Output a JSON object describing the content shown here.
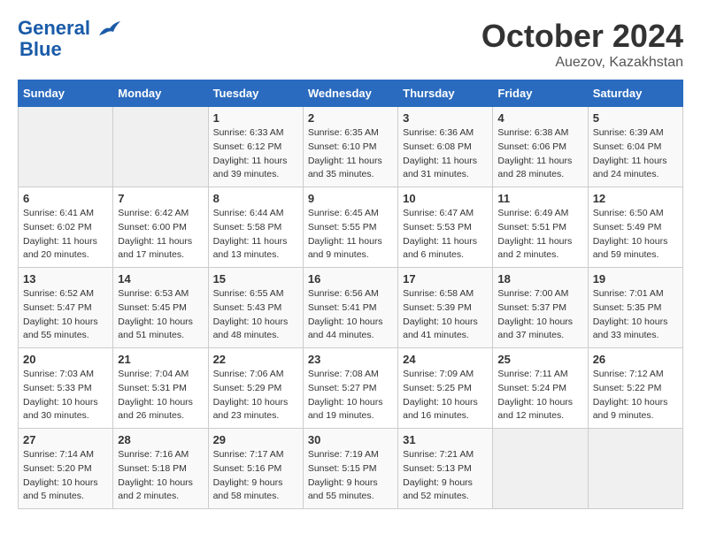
{
  "header": {
    "logo_line1": "General",
    "logo_line2": "Blue",
    "month": "October 2024",
    "location": "Auezov, Kazakhstan"
  },
  "days_of_week": [
    "Sunday",
    "Monday",
    "Tuesday",
    "Wednesday",
    "Thursday",
    "Friday",
    "Saturday"
  ],
  "weeks": [
    [
      {
        "num": "",
        "sunrise": "",
        "sunset": "",
        "daylight": ""
      },
      {
        "num": "",
        "sunrise": "",
        "sunset": "",
        "daylight": ""
      },
      {
        "num": "1",
        "sunrise": "Sunrise: 6:33 AM",
        "sunset": "Sunset: 6:12 PM",
        "daylight": "Daylight: 11 hours and 39 minutes."
      },
      {
        "num": "2",
        "sunrise": "Sunrise: 6:35 AM",
        "sunset": "Sunset: 6:10 PM",
        "daylight": "Daylight: 11 hours and 35 minutes."
      },
      {
        "num": "3",
        "sunrise": "Sunrise: 6:36 AM",
        "sunset": "Sunset: 6:08 PM",
        "daylight": "Daylight: 11 hours and 31 minutes."
      },
      {
        "num": "4",
        "sunrise": "Sunrise: 6:38 AM",
        "sunset": "Sunset: 6:06 PM",
        "daylight": "Daylight: 11 hours and 28 minutes."
      },
      {
        "num": "5",
        "sunrise": "Sunrise: 6:39 AM",
        "sunset": "Sunset: 6:04 PM",
        "daylight": "Daylight: 11 hours and 24 minutes."
      }
    ],
    [
      {
        "num": "6",
        "sunrise": "Sunrise: 6:41 AM",
        "sunset": "Sunset: 6:02 PM",
        "daylight": "Daylight: 11 hours and 20 minutes."
      },
      {
        "num": "7",
        "sunrise": "Sunrise: 6:42 AM",
        "sunset": "Sunset: 6:00 PM",
        "daylight": "Daylight: 11 hours and 17 minutes."
      },
      {
        "num": "8",
        "sunrise": "Sunrise: 6:44 AM",
        "sunset": "Sunset: 5:58 PM",
        "daylight": "Daylight: 11 hours and 13 minutes."
      },
      {
        "num": "9",
        "sunrise": "Sunrise: 6:45 AM",
        "sunset": "Sunset: 5:55 PM",
        "daylight": "Daylight: 11 hours and 9 minutes."
      },
      {
        "num": "10",
        "sunrise": "Sunrise: 6:47 AM",
        "sunset": "Sunset: 5:53 PM",
        "daylight": "Daylight: 11 hours and 6 minutes."
      },
      {
        "num": "11",
        "sunrise": "Sunrise: 6:49 AM",
        "sunset": "Sunset: 5:51 PM",
        "daylight": "Daylight: 11 hours and 2 minutes."
      },
      {
        "num": "12",
        "sunrise": "Sunrise: 6:50 AM",
        "sunset": "Sunset: 5:49 PM",
        "daylight": "Daylight: 10 hours and 59 minutes."
      }
    ],
    [
      {
        "num": "13",
        "sunrise": "Sunrise: 6:52 AM",
        "sunset": "Sunset: 5:47 PM",
        "daylight": "Daylight: 10 hours and 55 minutes."
      },
      {
        "num": "14",
        "sunrise": "Sunrise: 6:53 AM",
        "sunset": "Sunset: 5:45 PM",
        "daylight": "Daylight: 10 hours and 51 minutes."
      },
      {
        "num": "15",
        "sunrise": "Sunrise: 6:55 AM",
        "sunset": "Sunset: 5:43 PM",
        "daylight": "Daylight: 10 hours and 48 minutes."
      },
      {
        "num": "16",
        "sunrise": "Sunrise: 6:56 AM",
        "sunset": "Sunset: 5:41 PM",
        "daylight": "Daylight: 10 hours and 44 minutes."
      },
      {
        "num": "17",
        "sunrise": "Sunrise: 6:58 AM",
        "sunset": "Sunset: 5:39 PM",
        "daylight": "Daylight: 10 hours and 41 minutes."
      },
      {
        "num": "18",
        "sunrise": "Sunrise: 7:00 AM",
        "sunset": "Sunset: 5:37 PM",
        "daylight": "Daylight: 10 hours and 37 minutes."
      },
      {
        "num": "19",
        "sunrise": "Sunrise: 7:01 AM",
        "sunset": "Sunset: 5:35 PM",
        "daylight": "Daylight: 10 hours and 33 minutes."
      }
    ],
    [
      {
        "num": "20",
        "sunrise": "Sunrise: 7:03 AM",
        "sunset": "Sunset: 5:33 PM",
        "daylight": "Daylight: 10 hours and 30 minutes."
      },
      {
        "num": "21",
        "sunrise": "Sunrise: 7:04 AM",
        "sunset": "Sunset: 5:31 PM",
        "daylight": "Daylight: 10 hours and 26 minutes."
      },
      {
        "num": "22",
        "sunrise": "Sunrise: 7:06 AM",
        "sunset": "Sunset: 5:29 PM",
        "daylight": "Daylight: 10 hours and 23 minutes."
      },
      {
        "num": "23",
        "sunrise": "Sunrise: 7:08 AM",
        "sunset": "Sunset: 5:27 PM",
        "daylight": "Daylight: 10 hours and 19 minutes."
      },
      {
        "num": "24",
        "sunrise": "Sunrise: 7:09 AM",
        "sunset": "Sunset: 5:25 PM",
        "daylight": "Daylight: 10 hours and 16 minutes."
      },
      {
        "num": "25",
        "sunrise": "Sunrise: 7:11 AM",
        "sunset": "Sunset: 5:24 PM",
        "daylight": "Daylight: 10 hours and 12 minutes."
      },
      {
        "num": "26",
        "sunrise": "Sunrise: 7:12 AM",
        "sunset": "Sunset: 5:22 PM",
        "daylight": "Daylight: 10 hours and 9 minutes."
      }
    ],
    [
      {
        "num": "27",
        "sunrise": "Sunrise: 7:14 AM",
        "sunset": "Sunset: 5:20 PM",
        "daylight": "Daylight: 10 hours and 5 minutes."
      },
      {
        "num": "28",
        "sunrise": "Sunrise: 7:16 AM",
        "sunset": "Sunset: 5:18 PM",
        "daylight": "Daylight: 10 hours and 2 minutes."
      },
      {
        "num": "29",
        "sunrise": "Sunrise: 7:17 AM",
        "sunset": "Sunset: 5:16 PM",
        "daylight": "Daylight: 9 hours and 58 minutes."
      },
      {
        "num": "30",
        "sunrise": "Sunrise: 7:19 AM",
        "sunset": "Sunset: 5:15 PM",
        "daylight": "Daylight: 9 hours and 55 minutes."
      },
      {
        "num": "31",
        "sunrise": "Sunrise: 7:21 AM",
        "sunset": "Sunset: 5:13 PM",
        "daylight": "Daylight: 9 hours and 52 minutes."
      },
      {
        "num": "",
        "sunrise": "",
        "sunset": "",
        "daylight": ""
      },
      {
        "num": "",
        "sunrise": "",
        "sunset": "",
        "daylight": ""
      }
    ]
  ]
}
